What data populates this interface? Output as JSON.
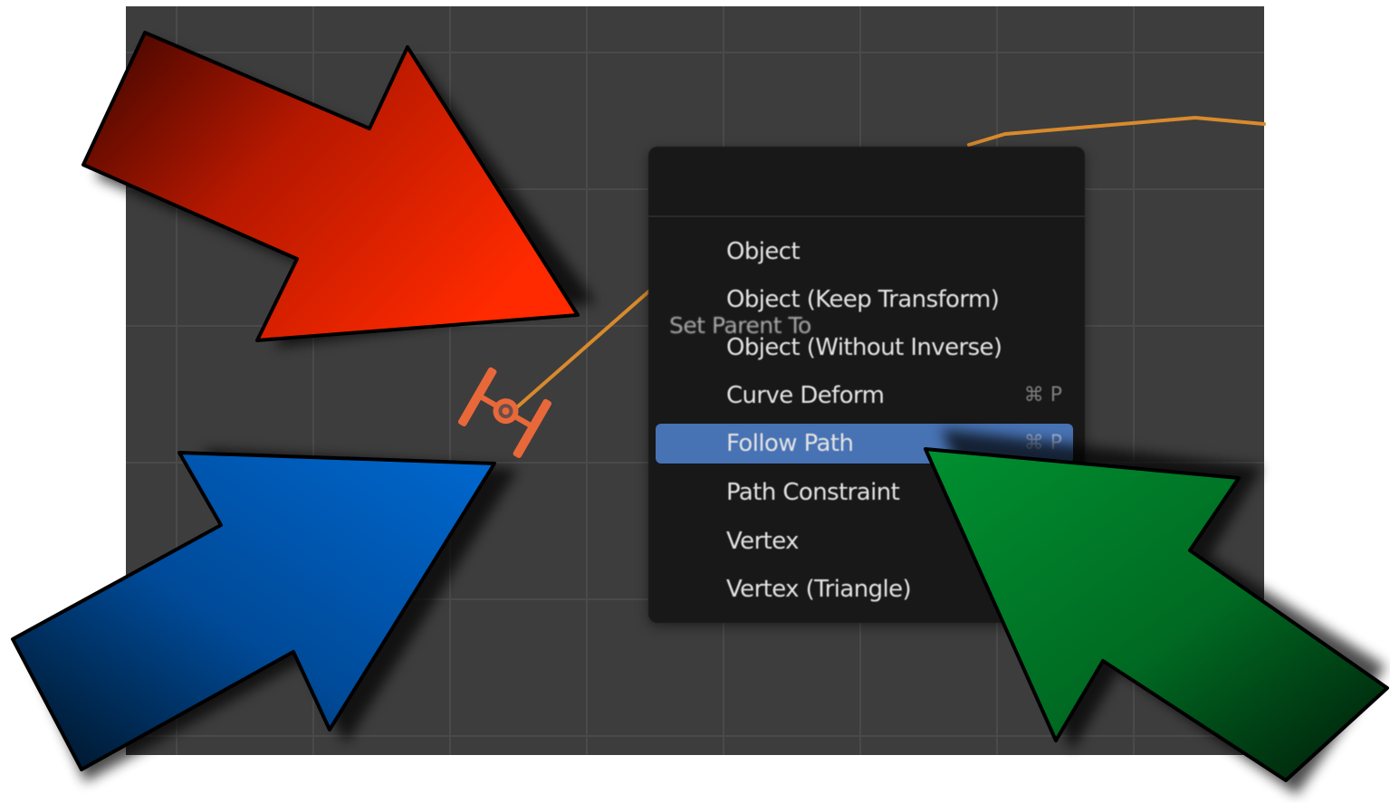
{
  "context_menu": {
    "title": "Set Parent To",
    "items": [
      {
        "label": "Object",
        "shortcut": ""
      },
      {
        "label": "Object (Keep Transform)",
        "shortcut": ""
      },
      {
        "label": "Object (Without Inverse)",
        "shortcut": ""
      },
      {
        "label": "Curve Deform",
        "shortcut": "⌘ P"
      },
      {
        "label": "Follow Path",
        "shortcut": "⌘ P",
        "active": true
      },
      {
        "label": "Path Constraint",
        "shortcut": ""
      },
      {
        "label": "Vertex",
        "shortcut": ""
      },
      {
        "label": "Vertex (Triangle)",
        "shortcut": ""
      }
    ]
  },
  "colors": {
    "viewport_bg": "#3d3d3d",
    "menu_bg": "#181818",
    "highlight": "#4772b3",
    "curve": "#e0902a",
    "object": "#ea6a3a",
    "arrow_red": "#f02800",
    "arrow_blue": "#0060c0",
    "arrow_green": "#008030"
  },
  "icons": {
    "ship": "tie-fighter-object-icon",
    "arrows": [
      "red-arrow",
      "blue-arrow",
      "green-arrow"
    ]
  }
}
